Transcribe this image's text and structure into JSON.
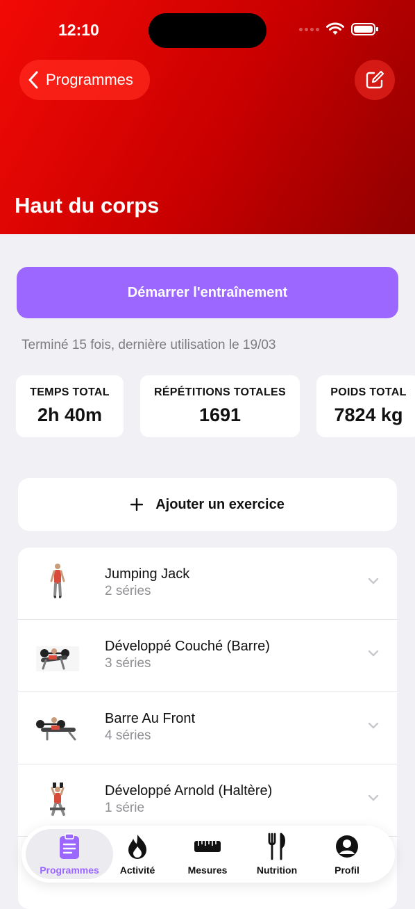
{
  "status_bar": {
    "time": "12:10"
  },
  "nav": {
    "back_label": "Programmes"
  },
  "page": {
    "title": "Haut du corps"
  },
  "start_button": "Démarrer l'entraînement",
  "usage_text": "Terminé 15 fois, dernière utilisation le 19/03",
  "stats": [
    {
      "title": "TEMPS TOTAL",
      "value": "2h 40m"
    },
    {
      "title": "RÉPÉTITIONS TOTALES",
      "value": "1691"
    },
    {
      "title": "POIDS TOTAL",
      "value": "7824 kg"
    }
  ],
  "add_exercise_label": "Ajouter un exercice",
  "exercises": [
    {
      "name": "Jumping Jack",
      "sets": "2 séries"
    },
    {
      "name": "Développé Couché (Barre)",
      "sets": "3 séries"
    },
    {
      "name": "Barre Au Front",
      "sets": "4 séries"
    },
    {
      "name": "Développé Arnold (Haltère)",
      "sets": "1 série"
    }
  ],
  "tabs": [
    {
      "label": "Programmes",
      "icon": "clipboard-icon",
      "active": true
    },
    {
      "label": "Activité",
      "icon": "flame-icon"
    },
    {
      "label": "Mesures",
      "icon": "ruler-icon"
    },
    {
      "label": "Nutrition",
      "icon": "fork-knife-icon"
    },
    {
      "label": "Profil",
      "icon": "person-circle-icon"
    }
  ],
  "colors": {
    "header_red": "#e00000",
    "accent_purple": "#9b67ff",
    "background": "#f1f1f5"
  }
}
